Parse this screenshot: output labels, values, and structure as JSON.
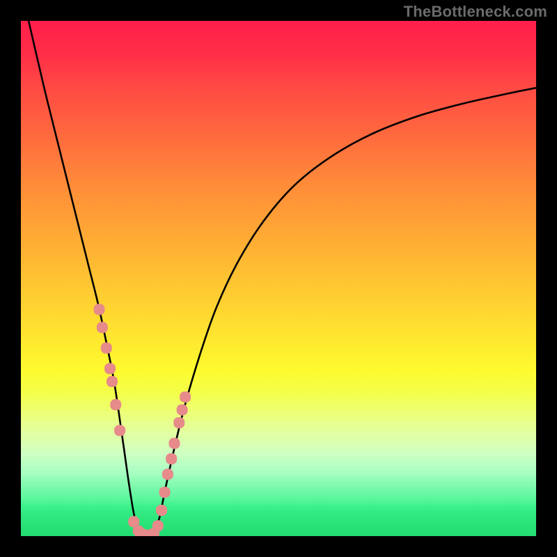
{
  "watermark": "TheBottleneck.com",
  "chart_data": {
    "type": "line",
    "title": "",
    "xlabel": "",
    "ylabel": "",
    "xlim": [
      0,
      100
    ],
    "ylim": [
      0,
      100
    ],
    "grid": false,
    "series": [
      {
        "name": "bottleneck-curve",
        "color": "#000000",
        "x": [
          1.5,
          3,
          5,
          7,
          9,
          11,
          13,
          15,
          16.5,
          18,
          19,
          20,
          21,
          22,
          23,
          24,
          25,
          26,
          27,
          28,
          30,
          32,
          35,
          38,
          42,
          47,
          53,
          60,
          68,
          77,
          86,
          95,
          100
        ],
        "y": [
          100,
          93.5,
          85,
          77,
          69,
          61,
          53,
          45,
          38,
          30.5,
          24,
          17,
          10,
          4,
          1,
          0,
          0,
          1,
          4,
          9,
          18,
          26,
          36,
          44.5,
          53,
          61,
          68,
          73.5,
          78,
          81.5,
          84,
          86,
          87
        ]
      }
    ],
    "points": {
      "name": "highlight-points",
      "color": "#e68a8a",
      "x": [
        15.2,
        15.8,
        16.6,
        17.3,
        17.7,
        18.4,
        19.2,
        21.9,
        22.8,
        23.5,
        24.2,
        25.0,
        25.8,
        26.6,
        27.3,
        27.9,
        28.5,
        29.2,
        29.8,
        30.7,
        31.3,
        31.9
      ],
      "y": [
        44.0,
        40.5,
        36.5,
        32.5,
        30.0,
        25.5,
        20.5,
        2.8,
        1.0,
        0.4,
        0.2,
        0.2,
        0.5,
        2.0,
        5.0,
        8.5,
        12.0,
        15.0,
        18.0,
        22.0,
        24.5,
        27.0
      ]
    },
    "background_gradient": {
      "top_color": "#ff1f4b",
      "mid_color": "#ffe92f",
      "bottom_color": "#24dd72"
    },
    "visible_banding": {
      "description": "horizontal subtle stripes in lower portion of gradient",
      "y_positions_pct": [
        74,
        76,
        78,
        80,
        82,
        84,
        86,
        88
      ]
    }
  }
}
